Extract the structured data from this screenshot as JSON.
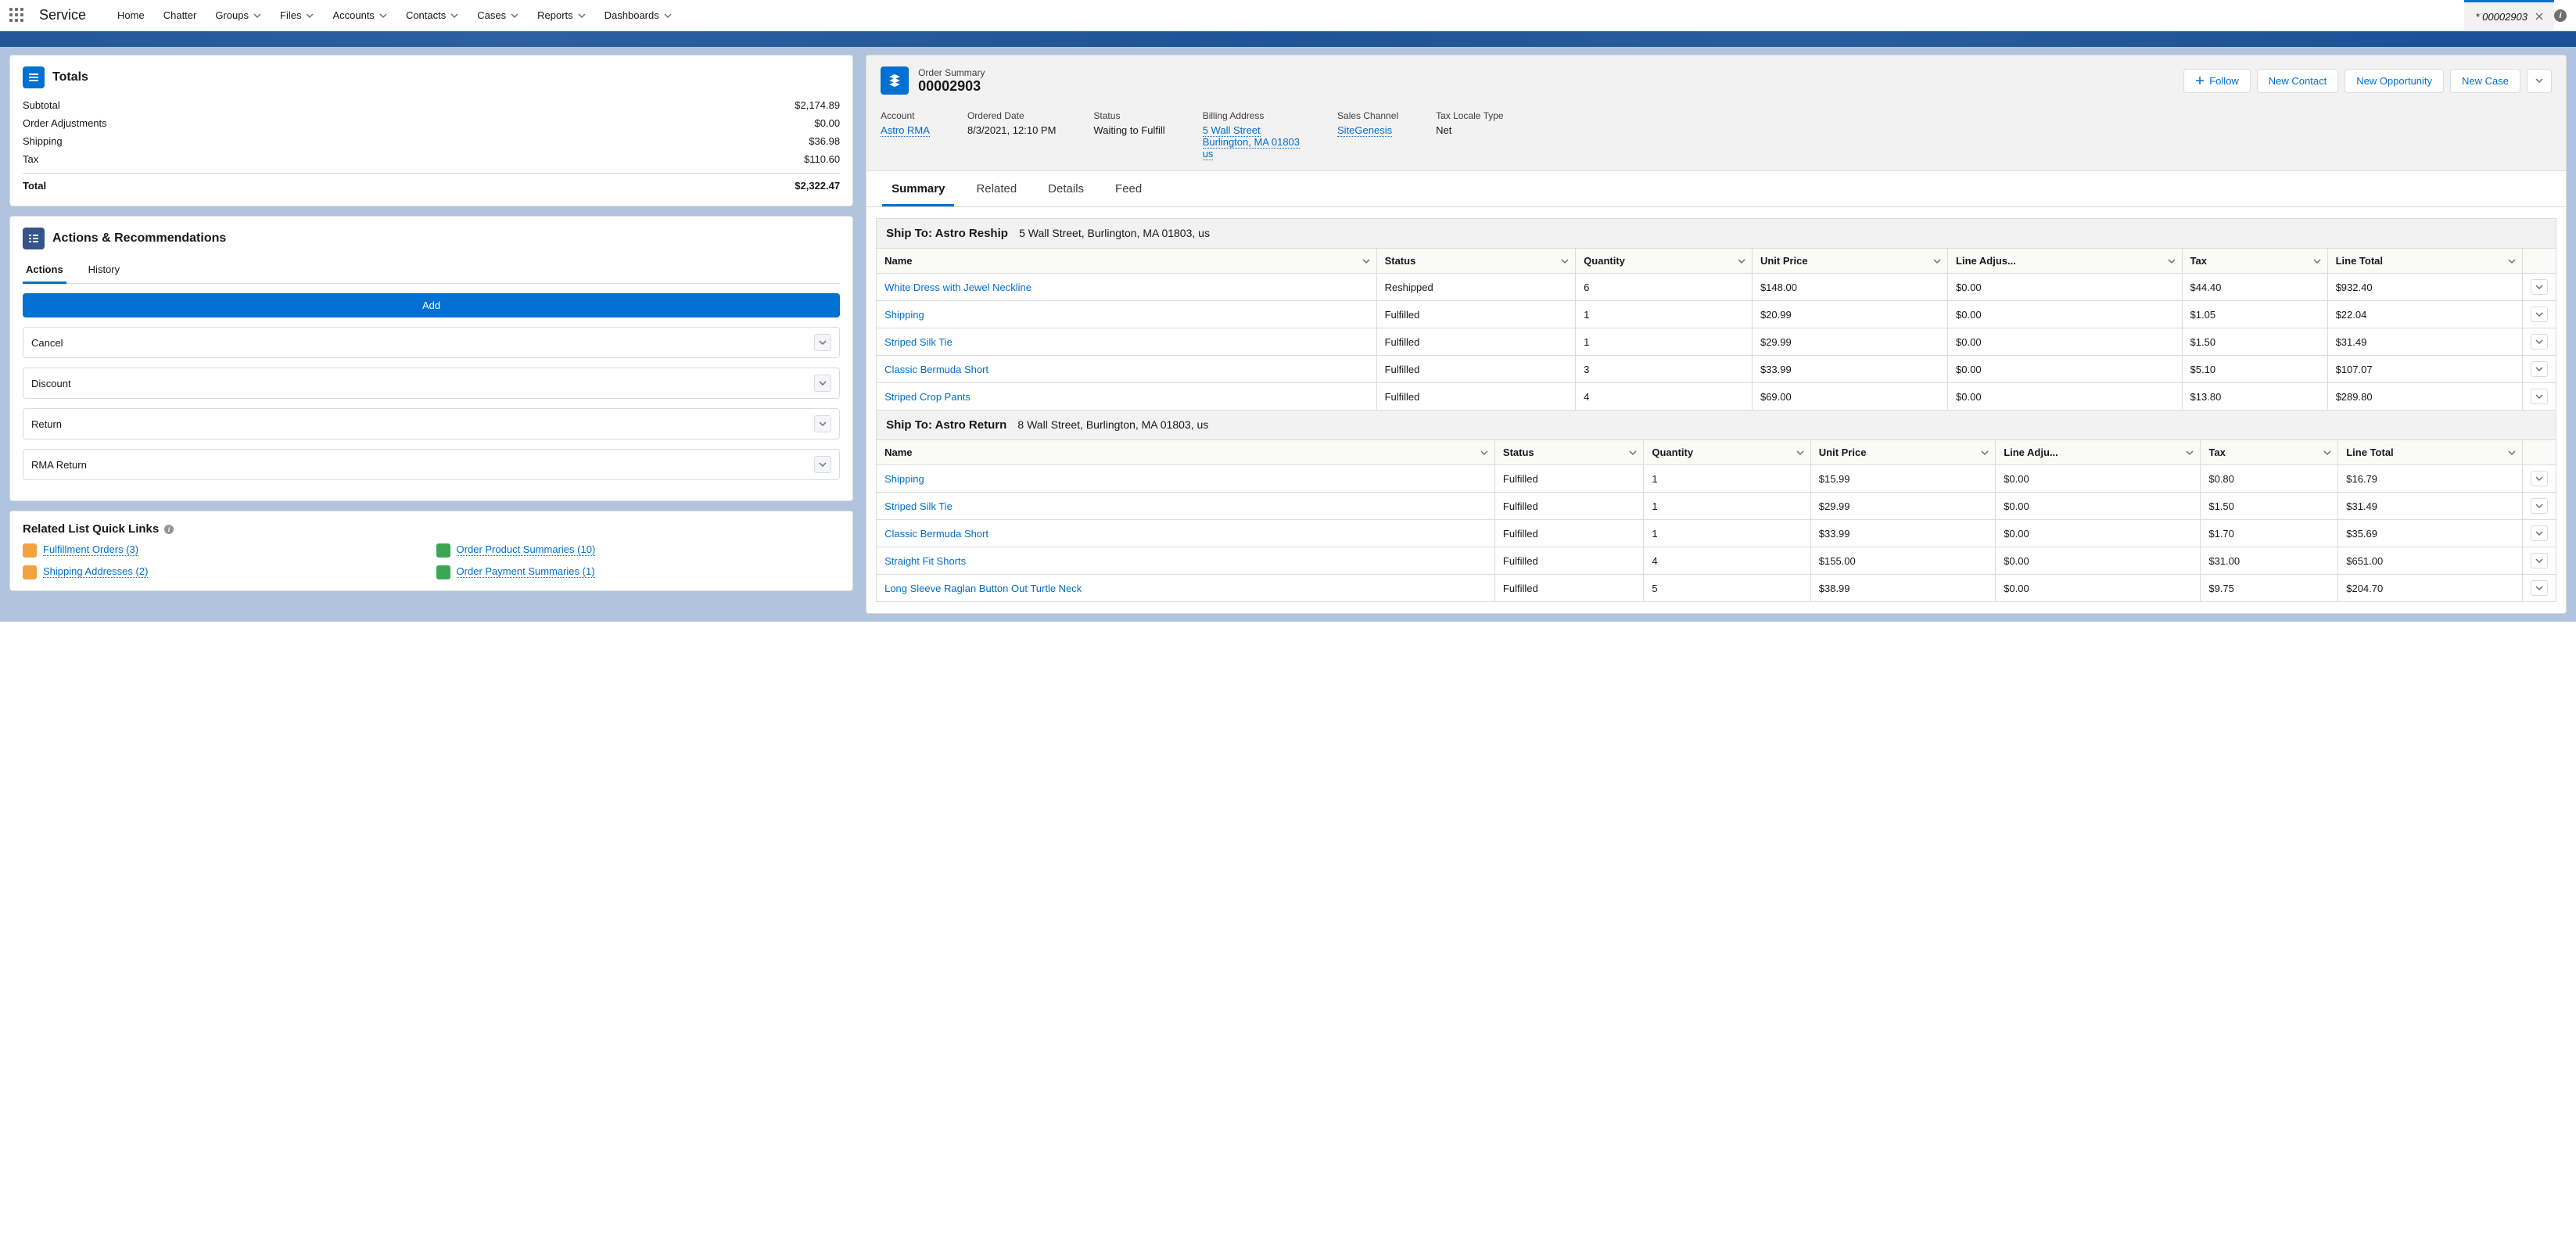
{
  "app_name": "Service",
  "nav": {
    "items": [
      {
        "label": "Home",
        "menu": false
      },
      {
        "label": "Chatter",
        "menu": false
      },
      {
        "label": "Groups",
        "menu": true
      },
      {
        "label": "Files",
        "menu": true
      },
      {
        "label": "Accounts",
        "menu": true
      },
      {
        "label": "Contacts",
        "menu": true
      },
      {
        "label": "Cases",
        "menu": true
      },
      {
        "label": "Reports",
        "menu": true
      },
      {
        "label": "Dashboards",
        "menu": true
      }
    ],
    "active_tab": "* 00002903"
  },
  "totals": {
    "title": "Totals",
    "rows": [
      {
        "label": "Subtotal",
        "value": "$2,174.89"
      },
      {
        "label": "Order Adjustments",
        "value": "$0.00"
      },
      {
        "label": "Shipping",
        "value": "$36.98"
      },
      {
        "label": "Tax",
        "value": "$110.60"
      }
    ],
    "total_label": "Total",
    "total_value": "$2,322.47"
  },
  "actions_card": {
    "title": "Actions & Recommendations",
    "tabs": [
      "Actions",
      "History"
    ],
    "add_label": "Add",
    "options": [
      "Cancel",
      "Discount",
      "Return",
      "RMA Return"
    ]
  },
  "rlql": {
    "title": "Related List Quick Links",
    "items": [
      {
        "label": "Fulfillment Orders (3)",
        "color": "#f2a340"
      },
      {
        "label": "Order Product Summaries (10)",
        "color": "#3ba755"
      },
      {
        "label": "Shipping Addresses (2)",
        "color": "#f2a340"
      },
      {
        "label": "Order Payment Summaries (1)",
        "color": "#3ba755"
      }
    ]
  },
  "highlights": {
    "object_label": "Order Summary",
    "record_name": "00002903",
    "actions": {
      "follow": "Follow",
      "new_contact": "New Contact",
      "new_opp": "New Opportunity",
      "new_case": "New Case"
    },
    "fields": {
      "account": {
        "label": "Account",
        "value": "Astro RMA"
      },
      "ordered": {
        "label": "Ordered Date",
        "value": "8/3/2021, 12:10 PM"
      },
      "status": {
        "label": "Status",
        "value": "Waiting to Fulfill"
      },
      "billing": {
        "label": "Billing Address",
        "line1": "5 Wall Street",
        "line2": "Burlington, MA 01803",
        "line3": "us"
      },
      "channel": {
        "label": "Sales Channel",
        "value": "SiteGenesis"
      },
      "taxlocale": {
        "label": "Tax Locale Type",
        "value": "Net"
      }
    }
  },
  "record_tabs": [
    "Summary",
    "Related",
    "Details",
    "Feed"
  ],
  "columns": {
    "name": "Name",
    "status": "Status",
    "qty": "Quantity",
    "unit": "Unit Price",
    "adj": "Line Adjus...",
    "adj2": "Line Adju...",
    "tax": "Tax",
    "total": "Line Total"
  },
  "ship1": {
    "label": "Ship To: Astro Reship",
    "address": "5 Wall Street, Burlington, MA  01803, us",
    "rows": [
      {
        "name": "White Dress with Jewel Neckline",
        "status": "Reshipped",
        "qty": "6",
        "unit": "$148.00",
        "adj": "$0.00",
        "tax": "$44.40",
        "total": "$932.40"
      },
      {
        "name": "Shipping",
        "status": "Fulfilled",
        "qty": "1",
        "unit": "$20.99",
        "adj": "$0.00",
        "tax": "$1.05",
        "total": "$22.04"
      },
      {
        "name": "Striped Silk Tie",
        "status": "Fulfilled",
        "qty": "1",
        "unit": "$29.99",
        "adj": "$0.00",
        "tax": "$1.50",
        "total": "$31.49"
      },
      {
        "name": "Classic Bermuda Short",
        "status": "Fulfilled",
        "qty": "3",
        "unit": "$33.99",
        "adj": "$0.00",
        "tax": "$5.10",
        "total": "$107.07"
      },
      {
        "name": "Striped Crop Pants",
        "status": "Fulfilled",
        "qty": "4",
        "unit": "$69.00",
        "adj": "$0.00",
        "tax": "$13.80",
        "total": "$289.80"
      }
    ]
  },
  "ship2": {
    "label": "Ship To: Astro Return",
    "address": "8 Wall Street, Burlington, MA  01803, us",
    "rows": [
      {
        "name": "Shipping",
        "status": "Fulfilled",
        "qty": "1",
        "unit": "$15.99",
        "adj": "$0.00",
        "tax": "$0.80",
        "total": "$16.79"
      },
      {
        "name": "Striped Silk Tie",
        "status": "Fulfilled",
        "qty": "1",
        "unit": "$29.99",
        "adj": "$0.00",
        "tax": "$1.50",
        "total": "$31.49"
      },
      {
        "name": "Classic Bermuda Short",
        "status": "Fulfilled",
        "qty": "1",
        "unit": "$33.99",
        "adj": "$0.00",
        "tax": "$1.70",
        "total": "$35.69"
      },
      {
        "name": "Straight Fit Shorts",
        "status": "Fulfilled",
        "qty": "4",
        "unit": "$155.00",
        "adj": "$0.00",
        "tax": "$31.00",
        "total": "$651.00"
      },
      {
        "name": "Long Sleeve Raglan Button Out Turtle Neck",
        "status": "Fulfilled",
        "qty": "5",
        "unit": "$38.99",
        "adj": "$0.00",
        "tax": "$9.75",
        "total": "$204.70"
      }
    ]
  }
}
